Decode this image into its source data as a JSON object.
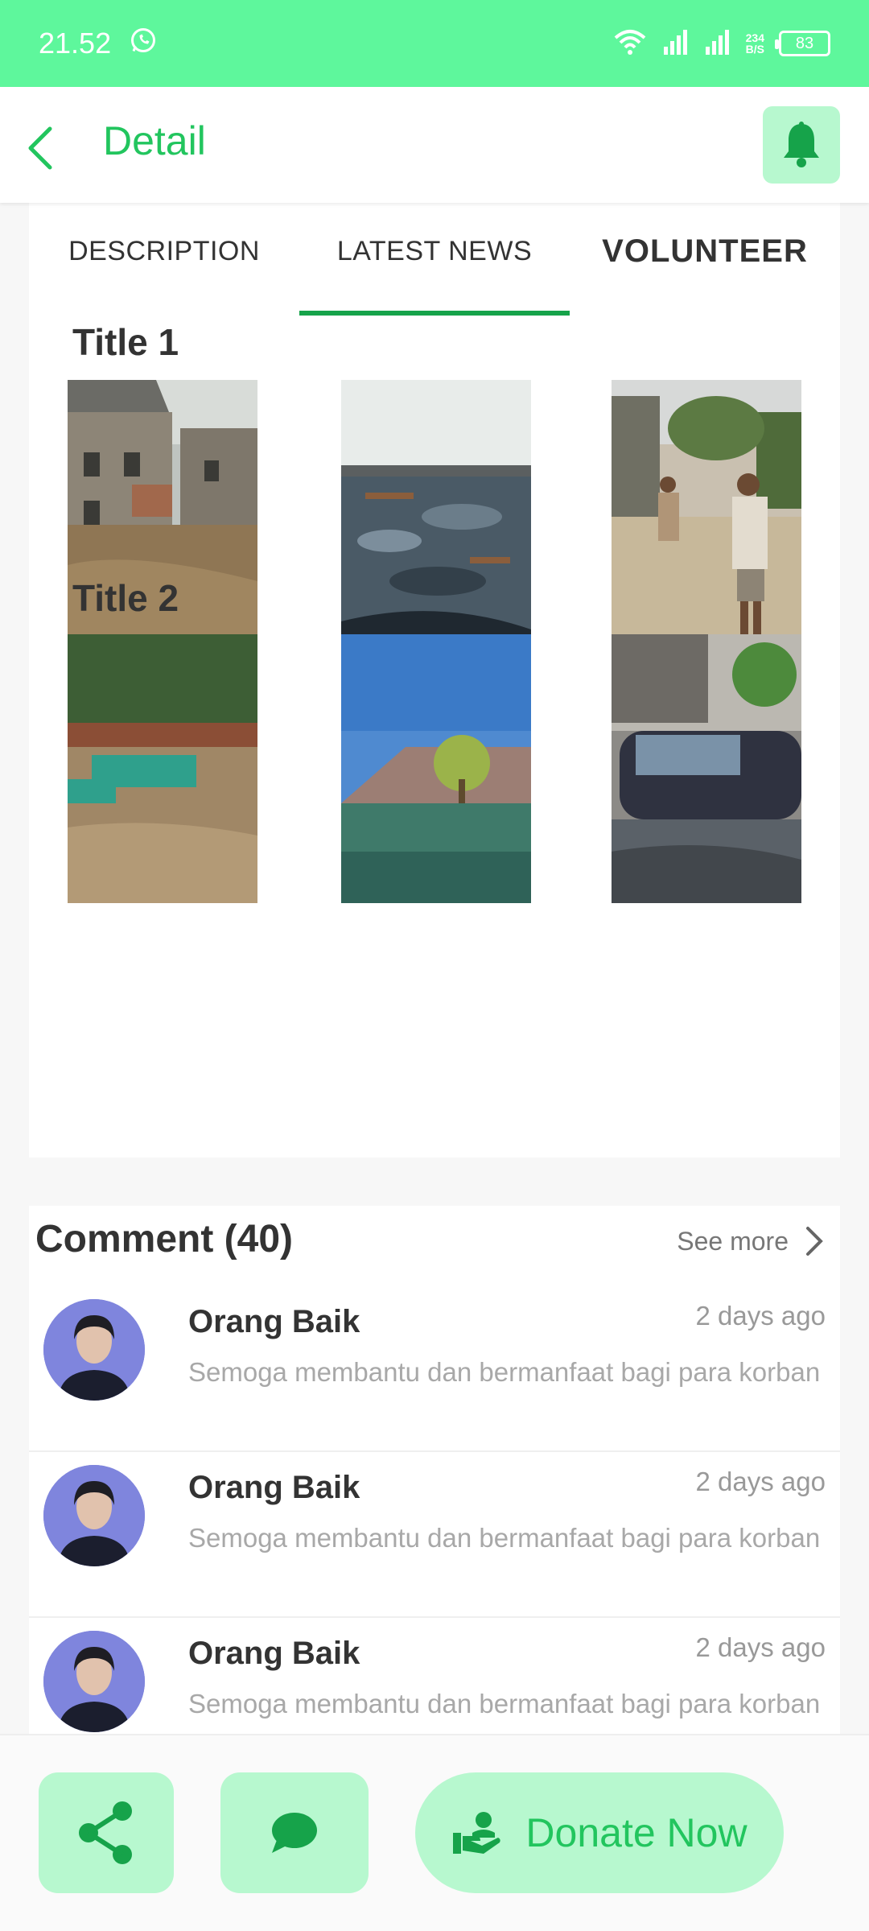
{
  "status_bar": {
    "time": "21.52",
    "net_speed_value": "234",
    "net_speed_unit": "B/S",
    "battery": "83"
  },
  "header": {
    "title": "Detail",
    "accent_color": "#22c55e"
  },
  "tabs": [
    {
      "label": "DESCRIPTION"
    },
    {
      "label": "LATEST NEWS",
      "active": true
    },
    {
      "label": "VOLUNTEER"
    }
  ],
  "news": [
    {
      "title": "Title 1",
      "images": [
        "flooded-village-photo",
        "flood-debris-photo",
        "people-wading-photo"
      ]
    },
    {
      "title": "Title 2",
      "images": [
        "submerged-truck-photo",
        "submerged-house-photo",
        "car-in-flood-photo"
      ]
    }
  ],
  "comments": {
    "header": "Comment (40)",
    "see_more": "See more",
    "items": [
      {
        "name": "Orang Baik",
        "time": "2 days ago",
        "text": "Semoga membantu dan bermanfaat bagi para korban"
      },
      {
        "name": "Orang Baik",
        "time": "2 days ago",
        "text": "Semoga membantu dan bermanfaat bagi para korban"
      },
      {
        "name": "Orang Baik",
        "time": "2 days ago",
        "text": "Semoga membantu dan bermanfaat bagi para korban"
      }
    ]
  },
  "actions": {
    "donate_label": "Donate Now"
  }
}
